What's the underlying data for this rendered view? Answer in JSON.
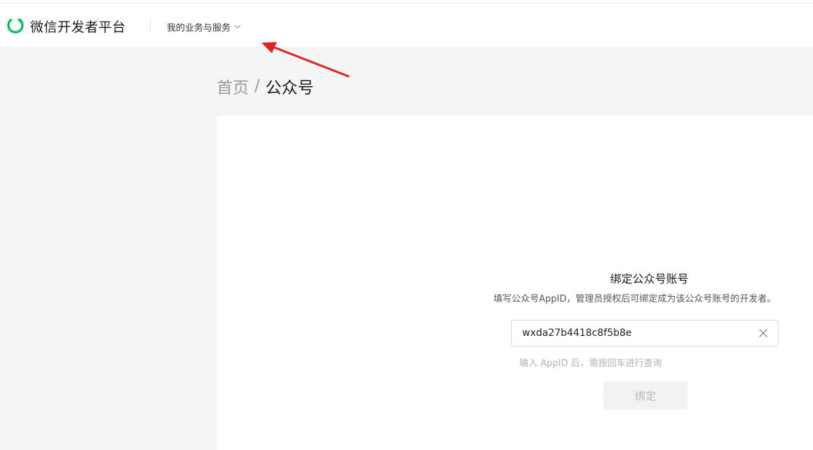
{
  "header": {
    "logo_text": "微信开发者平台",
    "nav_menu_label": "我的业务与服务"
  },
  "breadcrumb": {
    "home": "首页",
    "separator": "/",
    "current": "公众号"
  },
  "bind_form": {
    "title": "绑定公众号账号",
    "description": "填写公众号AppID，管理员授权后可绑定成为该公众号账号的开发者。",
    "appid_value": "wxda27b4418c8f5b8e",
    "hint": "输入 AppID 后，需按回车进行查询",
    "bind_label": "绑定"
  },
  "colors": {
    "brand_green": "#07c160",
    "annotation_arrow": "#e02020"
  }
}
